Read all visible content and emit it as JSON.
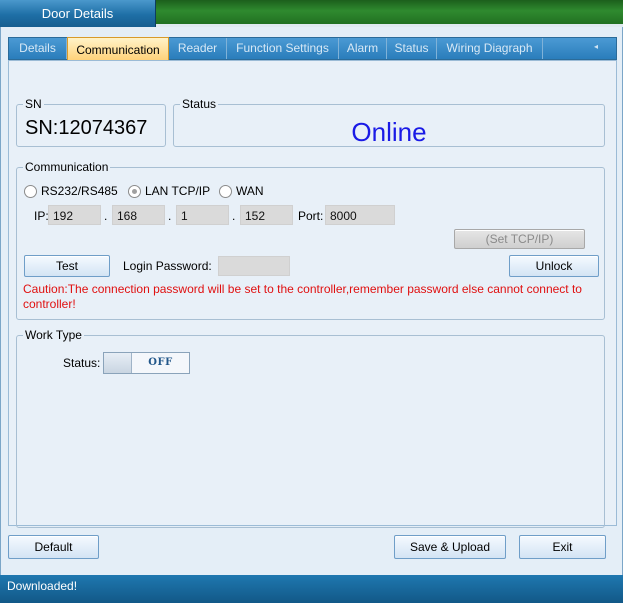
{
  "window": {
    "title": "Door Details"
  },
  "tabs": [
    {
      "label": "Details"
    },
    {
      "label": "Communication"
    },
    {
      "label": "Reader"
    },
    {
      "label": "Function Settings"
    },
    {
      "label": "Alarm"
    },
    {
      "label": "Status"
    },
    {
      "label": "Wiring Diagraph"
    }
  ],
  "sn": {
    "legend": "SN",
    "value": "SN:12074367"
  },
  "status": {
    "legend": "Status",
    "value": "Online"
  },
  "communication": {
    "legend": "Communication",
    "modes": [
      "RS232/RS485",
      "LAN TCP/IP",
      "WAN"
    ],
    "selected_mode": "LAN TCP/IP",
    "ip_label": "IP:",
    "ip": [
      "192",
      "168",
      "1",
      "152"
    ],
    "ip_sep": ".",
    "port_label": "Port:",
    "port": "8000",
    "set_tcpip_label": "(Set TCP/IP)",
    "test_label": "Test",
    "login_password_label": "Login Password:",
    "login_password_value": "",
    "unlock_label": "Unlock",
    "caution": "Caution:The connection password will be set to the controller,remember password else cannot connect to controller!"
  },
  "work_type": {
    "legend": "Work Type",
    "status_label": "Status:",
    "toggle_state": "OFF"
  },
  "footer": {
    "default_label": "Default",
    "save_label": "Save & Upload",
    "exit_label": "Exit"
  },
  "statusbar": {
    "text": "Downloaded!"
  },
  "colors": {
    "online": "#1a1ae6",
    "caution": "#e01010",
    "active_tab": "#ffd27a",
    "titlebar": "#2f8a2f"
  }
}
